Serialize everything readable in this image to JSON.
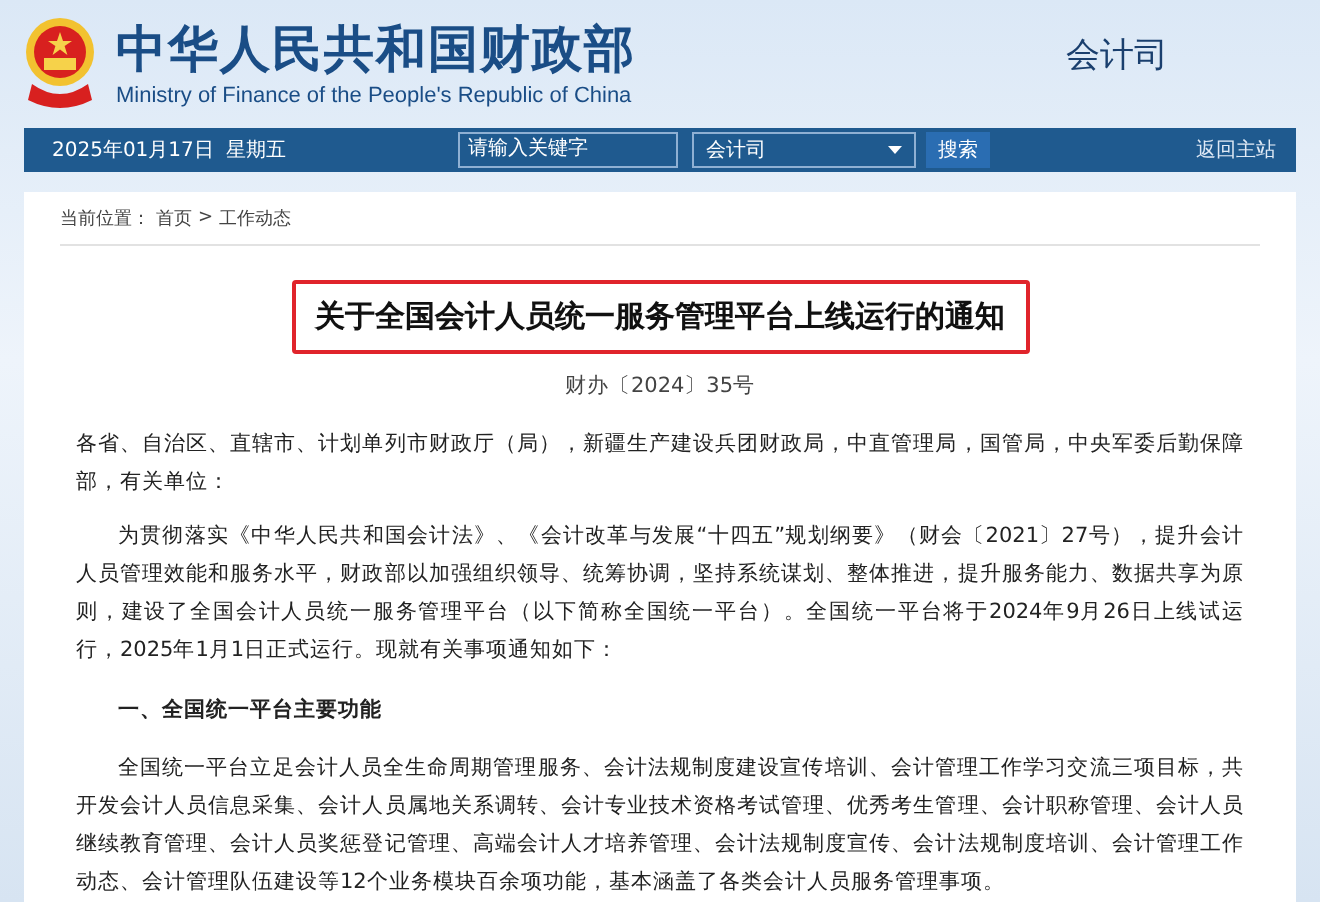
{
  "header": {
    "title": "中华人民共和国财政部",
    "subtitle": "Ministry of Finance of the People's Republic of China",
    "department": "会计司"
  },
  "navbar": {
    "date": "2025年01月17日",
    "weekday": "星期五",
    "search": {
      "placeholder": "请输入关键字"
    },
    "select": {
      "value": "会计司"
    },
    "search_button": "搜索",
    "home_link": "返回主站"
  },
  "breadcrumb": {
    "label": "当前位置：",
    "items": [
      "首页",
      "工作动态"
    ],
    "separator": ">"
  },
  "article": {
    "title": "关于全国会计人员统一服务管理平台上线运行的通知",
    "doc_number": "财办〔2024〕35号",
    "blocks": [
      {
        "kind": "plain",
        "text": "各省、自治区、直辖市、计划单列市财政厅（局），新疆生产建设兵团财政局，中直管理局，国管局，中央军委后勤保障部，有关单位："
      },
      {
        "kind": "indented",
        "text": "为贯彻落实《中华人民共和国会计法》、《会计改革与发展“十四五”规划纲要》（财会〔2021〕27号），提升会计人员管理效能和服务水平，财政部以加强组织领导、统筹协调，坚持系统谋划、整体推进，提升服务能力、数据共享为原则，建设了全国会计人员统一服务管理平台（以下简称全国统一平台）。全国统一平台将于2024年9月26日上线试运行，2025年1月1日正式运行。现就有关事项通知如下："
      },
      {
        "kind": "heading",
        "text": "一、全国统一平台主要功能"
      },
      {
        "kind": "indented",
        "text": "全国统一平台立足会计人员全生命周期管理服务、会计法规制度建设宣传培训、会计管理工作学习交流三项目标，共开发会计人员信息采集、会计人员属地关系调转、会计专业技术资格考试管理、优秀考生管理、会计职称管理、会计人员继续教育管理、会计人员奖惩登记管理、高端会计人才培养管理、会计法规制度宣传、会计法规制度培训、会计管理工作动态、会计管理队伍建设等12个业务模块百余项功能，基本涵盖了各类会计人员服务管理事项。"
      }
    ]
  }
}
